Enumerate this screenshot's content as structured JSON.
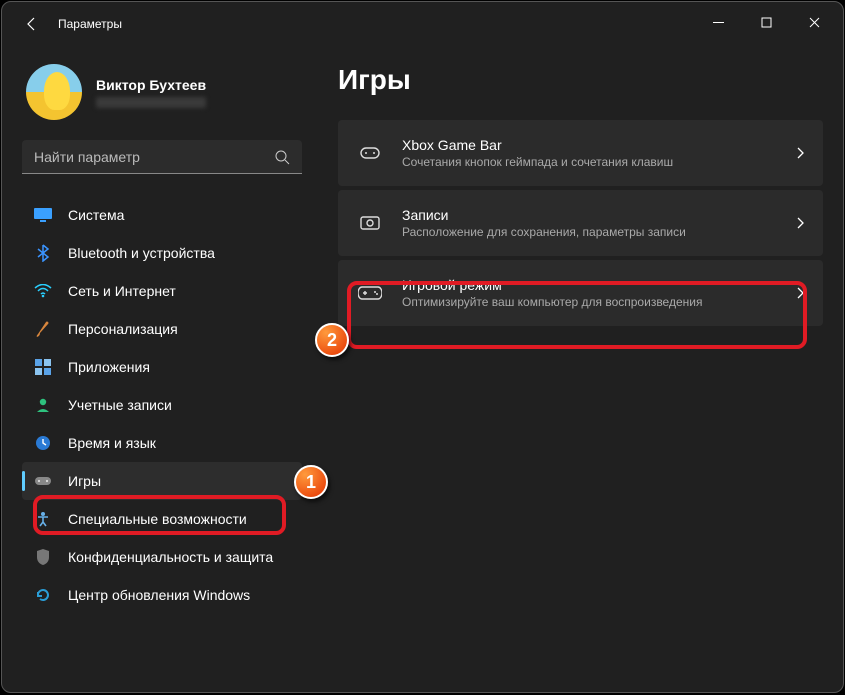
{
  "window": {
    "title": "Параметры"
  },
  "profile": {
    "name": "Виктор Бухтеев"
  },
  "search": {
    "placeholder": "Найти параметр"
  },
  "sidebar": {
    "items": [
      {
        "label": "Система"
      },
      {
        "label": "Bluetooth и устройства"
      },
      {
        "label": "Сеть и Интернет"
      },
      {
        "label": "Персонализация"
      },
      {
        "label": "Приложения"
      },
      {
        "label": "Учетные записи"
      },
      {
        "label": "Время и язык"
      },
      {
        "label": "Игры"
      },
      {
        "label": "Специальные возможности"
      },
      {
        "label": "Конфиденциальность и защита"
      },
      {
        "label": "Центр обновления Windows"
      }
    ]
  },
  "page": {
    "title": "Игры"
  },
  "cards": [
    {
      "title": "Xbox Game Bar",
      "desc": "Сочетания кнопок геймпада и сочетания клавиш"
    },
    {
      "title": "Записи",
      "desc": "Расположение для сохранения, параметры записи"
    },
    {
      "title": "Игровой режим",
      "desc": "Оптимизируйте ваш компьютер для воспроизведения"
    }
  ],
  "annotations": {
    "b1": "1",
    "b2": "2"
  }
}
